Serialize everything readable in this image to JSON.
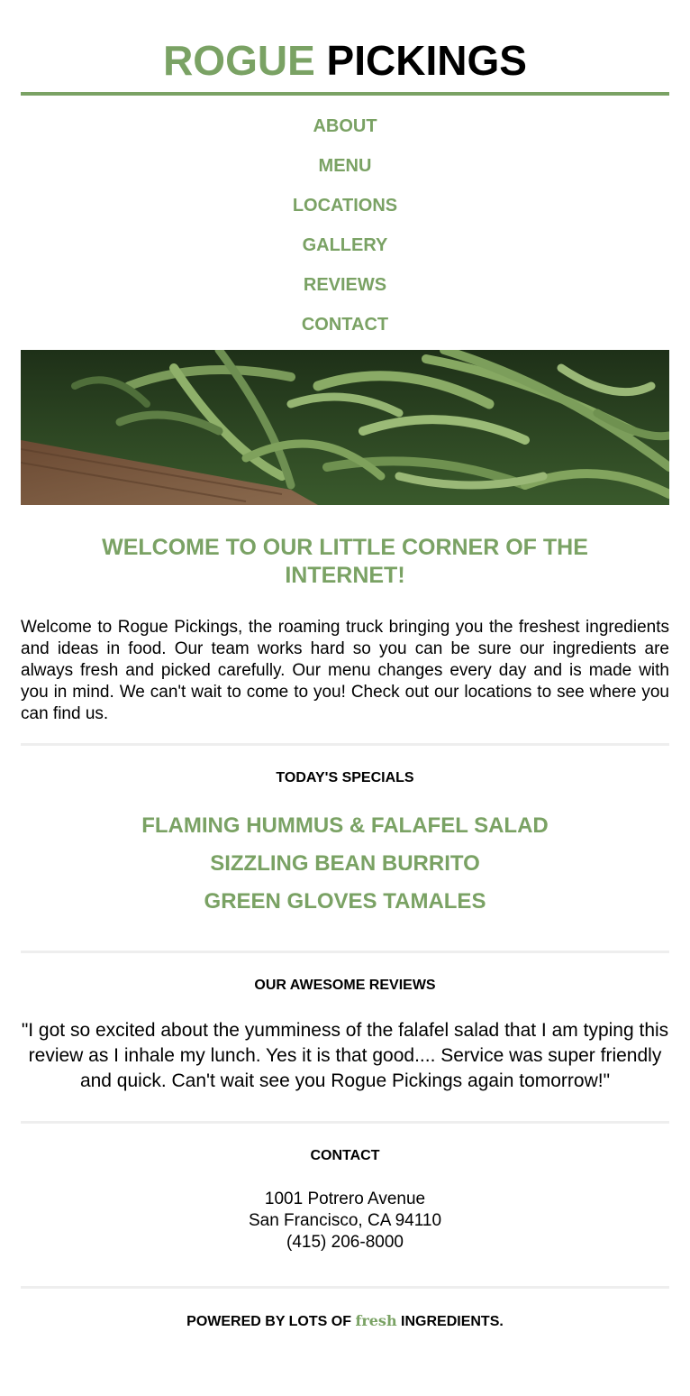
{
  "header": {
    "logo_part1": "ROGUE",
    "logo_part2": "PICKINGS"
  },
  "nav": {
    "items": [
      "ABOUT",
      "MENU",
      "LOCATIONS",
      "GALLERY",
      "REVIEWS",
      "CONTACT"
    ]
  },
  "welcome": {
    "heading": "WELCOME TO OUR LITTLE CORNER OF THE INTERNET!",
    "text": "Welcome to Rogue Pickings, the roaming truck bringing you the freshest ingredients and ideas in food. Our team works hard so you can be sure our ingredients are always fresh and picked carefully. Our menu changes every day and is made with you in mind. We can't wait to come to you! Check out our locations to see where you can find us."
  },
  "specials": {
    "title": "TODAY'S SPECIALS",
    "items": [
      "FLAMING HUMMUS & FALAFEL SALAD",
      "SIZZLING BEAN BURRITO",
      "GREEN GLOVES TAMALES"
    ]
  },
  "reviews": {
    "title": "OUR AWESOME REVIEWS",
    "quote": "\"I got so excited about the yumminess of the falafel salad that I am typing this review as I inhale my lunch. Yes it is that good.... Service was super friendly and quick. Can't wait see you Rogue Pickings again tomorrow!\""
  },
  "contact": {
    "title": "CONTACT",
    "address1": "1001 Potrero Avenue",
    "address2": "San Francisco, CA 94110",
    "phone": "(415) 206-8000"
  },
  "footer": {
    "before": "POWERED BY LOTS OF",
    "fresh": "fresh",
    "after": "INGREDIENTS."
  },
  "colors": {
    "accent": "#7aa264",
    "divider": "#eeeeee",
    "text": "#000000"
  }
}
